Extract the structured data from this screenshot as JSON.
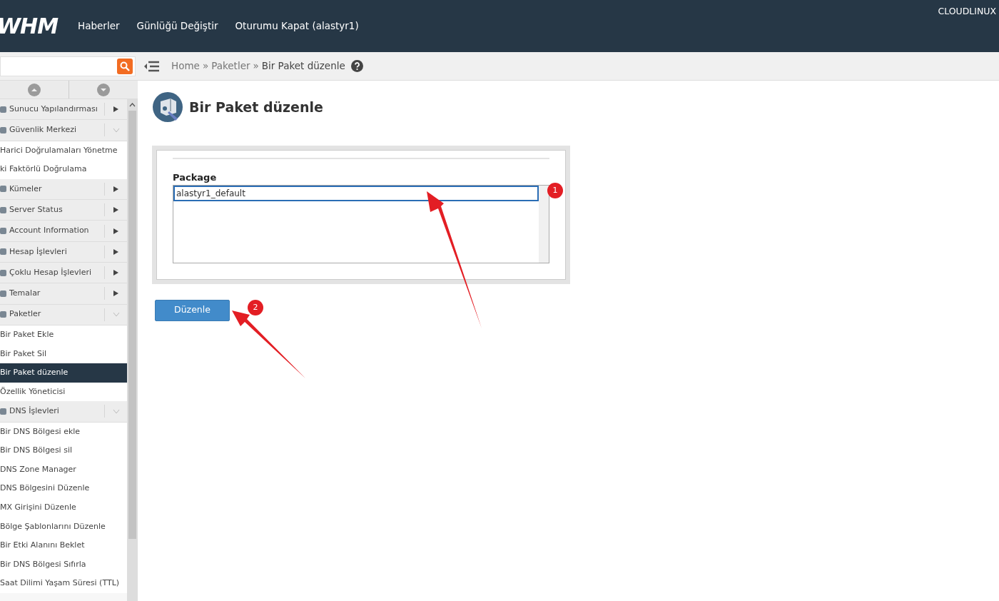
{
  "header": {
    "logo": "WHM",
    "brand": "CLOUDLINUX",
    "nav": [
      "Haberler",
      "Günlüğü Değiştir",
      "Oturumu Kapat (alastyr1)"
    ]
  },
  "breadcrumb": {
    "separator": "»",
    "items": [
      "Home",
      "Paketler",
      "Bir Paket düzenle"
    ]
  },
  "sidebar": {
    "items": [
      {
        "kind": "category",
        "text": "Sunucu Yapılandırması",
        "expanded": false
      },
      {
        "kind": "category",
        "text": "Güvenlik Merkezi",
        "expanded": true
      },
      {
        "kind": "link",
        "text": "Harici Doğrulamaları Yönetme",
        "selected": false
      },
      {
        "kind": "link",
        "text": "ki Faktörlü Doğrulama",
        "selected": false
      },
      {
        "kind": "category",
        "text": "Kümeler",
        "expanded": false
      },
      {
        "kind": "category",
        "text": "Server Status",
        "expanded": false
      },
      {
        "kind": "category",
        "text": "Account Information",
        "expanded": false
      },
      {
        "kind": "category",
        "text": "Hesap İşlevleri",
        "expanded": false
      },
      {
        "kind": "category",
        "text": "Çoklu Hesap İşlevleri",
        "expanded": false
      },
      {
        "kind": "category",
        "text": "Temalar",
        "expanded": false
      },
      {
        "kind": "category",
        "text": "Paketler",
        "expanded": true
      },
      {
        "kind": "link",
        "text": "Bir Paket Ekle",
        "selected": false
      },
      {
        "kind": "link",
        "text": "Bir Paket Sil",
        "selected": false
      },
      {
        "kind": "link",
        "text": "Bir Paket düzenle",
        "selected": true
      },
      {
        "kind": "link",
        "text": "Özellik Yöneticisi",
        "selected": false
      },
      {
        "kind": "category",
        "text": "DNS İşlevleri",
        "expanded": true
      },
      {
        "kind": "link",
        "text": "Bir DNS Bölgesi ekle",
        "selected": false
      },
      {
        "kind": "link",
        "text": "Bir DNS Bölgesi sil",
        "selected": false
      },
      {
        "kind": "link",
        "text": "DNS Zone Manager",
        "selected": false
      },
      {
        "kind": "link",
        "text": "DNS Bölgesini Düzenle",
        "selected": false
      },
      {
        "kind": "link",
        "text": "MX Girişini Düzenle",
        "selected": false
      },
      {
        "kind": "link",
        "text": "Bölge Şablonlarını Düzenle",
        "selected": false
      },
      {
        "kind": "link",
        "text": "Bir Etki Alanını Beklet",
        "selected": false
      },
      {
        "kind": "link",
        "text": "Bir DNS Bölgesi Sıfırla",
        "selected": false
      },
      {
        "kind": "link",
        "text": "Saat Dilimi Yaşam Süresi (TTL)",
        "selected": false
      }
    ]
  },
  "page": {
    "title": "Bir Paket düzenle",
    "form": {
      "label": "Package",
      "options": [
        {
          "text": "alastyr1_default",
          "selected": true
        }
      ]
    },
    "button": "Düzenle"
  },
  "annotations": [
    {
      "number": "1"
    },
    {
      "number": "2"
    }
  ]
}
